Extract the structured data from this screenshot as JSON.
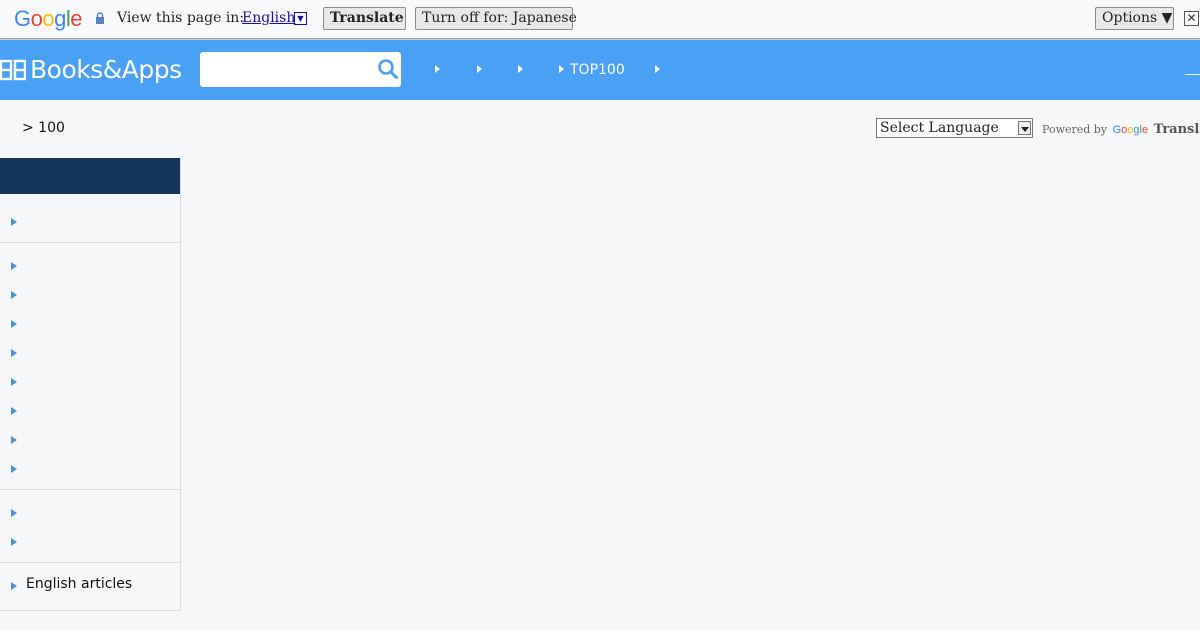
{
  "translate_bar": {
    "logo_text": "Google",
    "prompt": "View this page in:",
    "language": "English",
    "translate_label": "Translate",
    "turn_off_label": "Turn off for: Japanese",
    "options_label": "Options ▼",
    "close_label": "✕"
  },
  "header": {
    "logo_text": "Books&Apps",
    "search_placeholder": "",
    "nav": [
      {
        "label": ""
      },
      {
        "label": ""
      },
      {
        "label": ""
      },
      {
        "label": "TOP100"
      },
      {
        "label": ""
      }
    ]
  },
  "breadcrumb": "> 100",
  "language_widget": {
    "select_label": "Select Language",
    "powered_by": "Powered by",
    "google": "Google",
    "translate": "Translate"
  },
  "sidebar": {
    "header": "",
    "items": [
      {
        "label": ""
      },
      {
        "label": ""
      },
      {
        "label": ""
      },
      {
        "label": ""
      },
      {
        "label": ""
      },
      {
        "label": ""
      },
      {
        "label": ""
      },
      {
        "label": ""
      },
      {
        "label": ""
      },
      {
        "label": ""
      },
      {
        "label": ""
      },
      {
        "label": "English articles"
      }
    ]
  },
  "colors": {
    "header_bg": "#4aa0f5",
    "sidebar_header_bg": "#12365a",
    "accent_arrow": "#4a90d9"
  }
}
